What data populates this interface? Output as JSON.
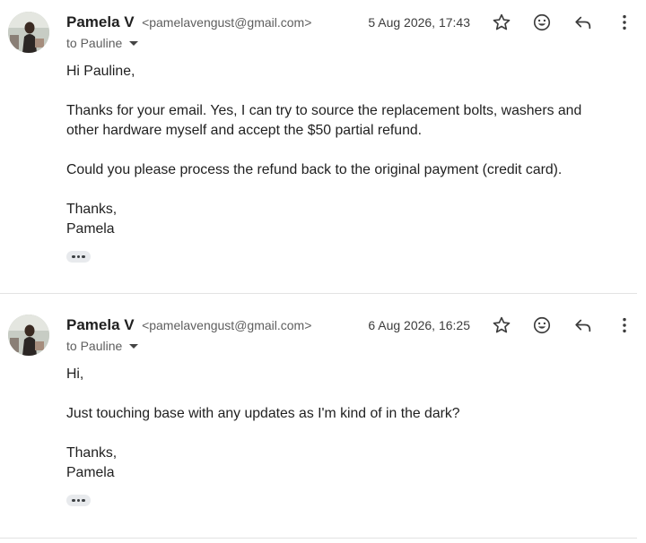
{
  "messages": [
    {
      "sender_name": "Pamela V",
      "sender_email": "<pamelavengust@gmail.com>",
      "recipient": "to Pauline",
      "timestamp": "5 Aug 2026, 17:43",
      "body": {
        "greeting": "Hi Pauline,",
        "paragraph_1": "Thanks for your email. Yes, I can try to source the replacement bolts, washers and other hardware myself and accept the $50 partial refund.",
        "paragraph_2": "Could you please process the refund back to the original payment (credit card).",
        "signoff": "Thanks,",
        "signature": "Pamela"
      }
    },
    {
      "sender_name": "Pamela V",
      "sender_email": "<pamelavengust@gmail.com>",
      "recipient": "to Pauline",
      "timestamp": "6 Aug 2026, 16:25",
      "body": {
        "greeting": "Hi,",
        "paragraph_1": "Just touching base with any updates as I'm kind of in the dark?",
        "signoff": "Thanks,",
        "signature": "Pamela"
      }
    }
  ],
  "icons": {
    "star": "star-icon",
    "emoji": "add-reaction-icon",
    "reply": "reply-icon",
    "more": "more-vert-icon",
    "expand": "show-trimmed-content-icon"
  },
  "colors": {
    "text": "#1f1f1f",
    "secondary_text": "#5e5e5e",
    "divider": "#e3e3e3",
    "ellipsis_bg": "#e8eaed"
  }
}
